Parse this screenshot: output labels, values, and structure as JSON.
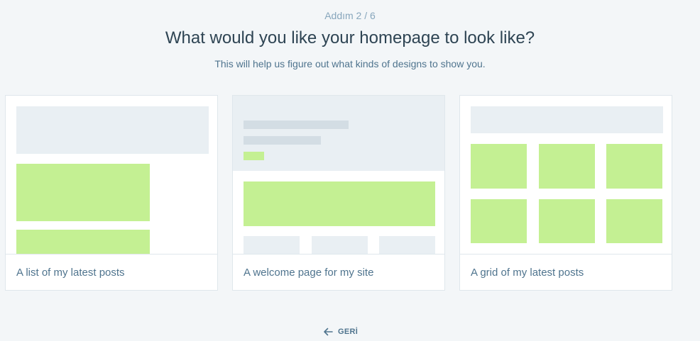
{
  "header": {
    "step": "Addım 2 / 6",
    "title": "What would you like your homepage to look like?",
    "subtitle": "This will help us figure out what kinds of designs to show you."
  },
  "options": [
    {
      "label": "A list of my latest posts"
    },
    {
      "label": "A welcome page for my site"
    },
    {
      "label": "A grid of my latest posts"
    }
  ],
  "footer": {
    "back_label": "GERİ",
    "back_icon": "arrow-left-icon"
  }
}
